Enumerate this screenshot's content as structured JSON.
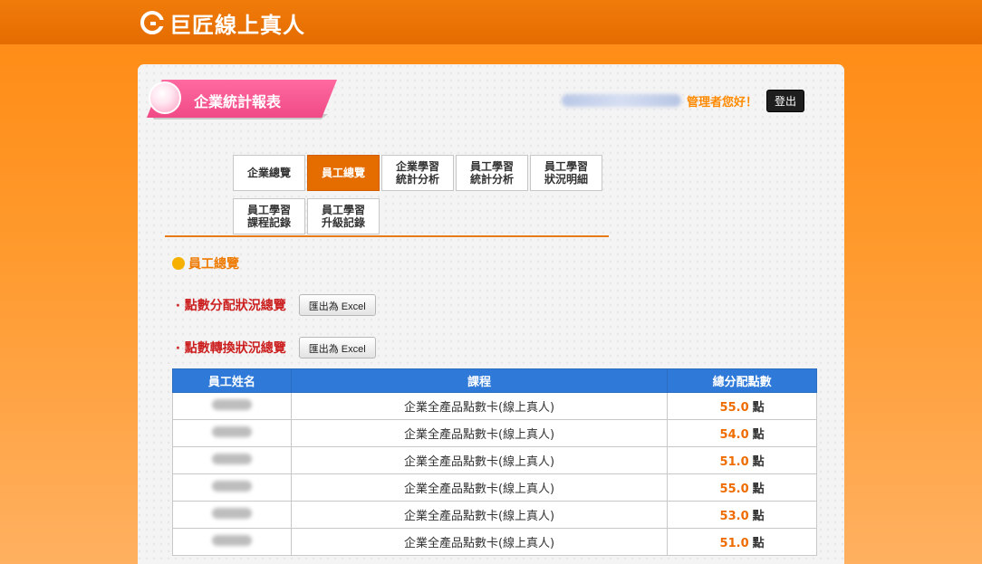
{
  "brand": {
    "name": "巨匠線上真人"
  },
  "header": {
    "title": "企業統計報表",
    "greeting": "管理者您好！",
    "logout_label": "登出"
  },
  "tabs": [
    {
      "label": "企業總覽",
      "active": false
    },
    {
      "label": "員工總覽",
      "active": true
    },
    {
      "label": "企業學習\n統計分析",
      "active": false
    },
    {
      "label": "員工學習\n統計分析",
      "active": false
    },
    {
      "label": "員工學習\n狀況明細",
      "active": false
    },
    {
      "label": "員工學習\n課程記錄",
      "active": false
    },
    {
      "label": "員工學習\n升級記錄",
      "active": false
    }
  ],
  "section": {
    "title": "員工總覽"
  },
  "rows": [
    {
      "label": "‧ 點數分配狀況總覽",
      "button": "匯出為 Excel"
    },
    {
      "label": "‧ 點數轉換狀況總覽",
      "button": "匯出為 Excel"
    }
  ],
  "table": {
    "headers": [
      "員工姓名",
      "課程",
      "總分配點數"
    ],
    "unit": "點",
    "rows": [
      {
        "course": "企業全產品點數卡(線上真人)",
        "points": "55.0"
      },
      {
        "course": "企業全產品點數卡(線上真人)",
        "points": "54.0"
      },
      {
        "course": "企業全產品點數卡(線上真人)",
        "points": "51.0"
      },
      {
        "course": "企業全產品點數卡(線上真人)",
        "points": "55.0"
      },
      {
        "course": "企業全產品點數卡(線上真人)",
        "points": "53.0"
      },
      {
        "course": "企業全產品點數卡(線上真人)",
        "points": "51.0"
      }
    ]
  },
  "colors": {
    "brand_orange": "#e56d00",
    "ribbon_pink": "#f04a86",
    "table_header_blue": "#2f7ad8",
    "alert_red": "#cc1f1f"
  }
}
